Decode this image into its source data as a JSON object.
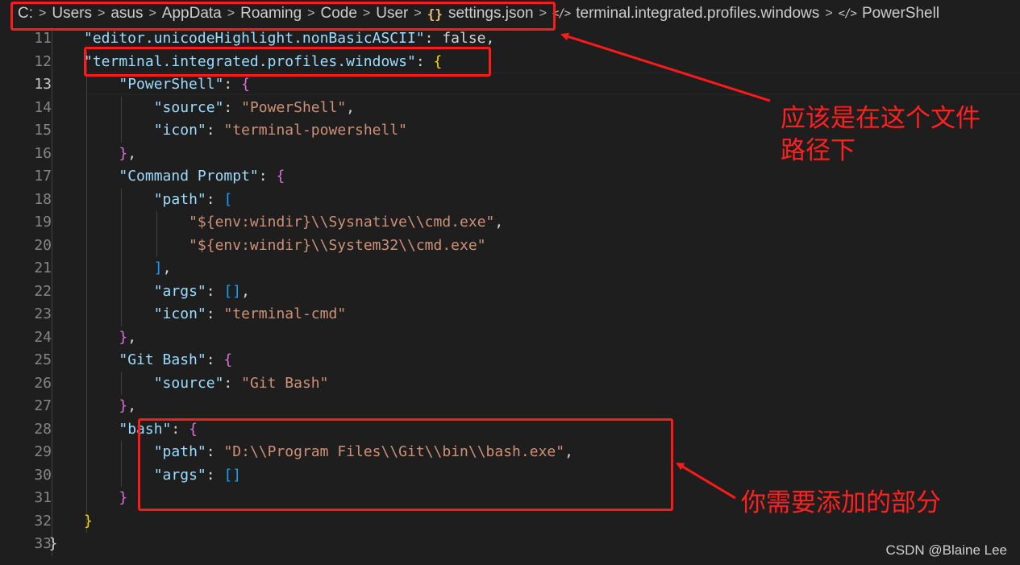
{
  "breadcrumb": {
    "items": [
      "C:",
      "Users",
      "asus",
      "AppData",
      "Roaming",
      "Code",
      "User",
      "settings.json",
      "terminal.integrated.profiles.windows",
      "PowerShell"
    ]
  },
  "editor": {
    "active_line": 13,
    "lines": [
      {
        "n": "11",
        "t": "\"editor.unicodeHighlight.nonBasicASCII\": false,"
      },
      {
        "n": "12",
        "t": "\"terminal.integrated.profiles.windows\": {"
      },
      {
        "n": "13",
        "t": "\"PowerShell\": {"
      },
      {
        "n": "14",
        "t": "\"source\": \"PowerShell\","
      },
      {
        "n": "15",
        "t": "\"icon\": \"terminal-powershell\""
      },
      {
        "n": "16",
        "t": "},"
      },
      {
        "n": "17",
        "t": "\"Command Prompt\": {"
      },
      {
        "n": "18",
        "t": "\"path\": ["
      },
      {
        "n": "19",
        "t": "\"${env:windir}\\\\Sysnative\\\\cmd.exe\","
      },
      {
        "n": "20",
        "t": "\"${env:windir}\\\\System32\\\\cmd.exe\""
      },
      {
        "n": "21",
        "t": "],"
      },
      {
        "n": "22",
        "t": "\"args\": [],"
      },
      {
        "n": "23",
        "t": "\"icon\": \"terminal-cmd\""
      },
      {
        "n": "24",
        "t": "},"
      },
      {
        "n": "25",
        "t": "\"Git Bash\": {"
      },
      {
        "n": "26",
        "t": "\"source\": \"Git Bash\""
      },
      {
        "n": "27",
        "t": "},"
      },
      {
        "n": "28",
        "t": "\"bash\": {"
      },
      {
        "n": "29",
        "t": "\"path\": \"D:\\\\Program Files\\\\Git\\\\bin\\\\bash.exe\","
      },
      {
        "n": "30",
        "t": "\"args\": []"
      },
      {
        "n": "31",
        "t": "}"
      },
      {
        "n": "32",
        "t": "}"
      },
      {
        "n": "33",
        "t": "}"
      }
    ]
  },
  "annotations": {
    "path_note_line1": "应该是在这个文件",
    "path_note_line2": "路径下",
    "add_note": "你需要添加的部分"
  },
  "watermark": "CSDN @Blaine Lee",
  "colors": {
    "background": "#1e1e1e",
    "key": "#9cdcfe",
    "string": "#ce9178",
    "boolean": "#569cd6",
    "annotation": "#ff1a1a"
  }
}
